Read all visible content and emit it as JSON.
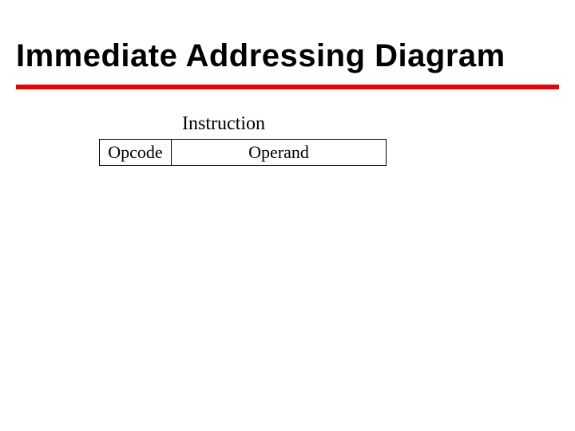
{
  "title": "Immediate Addressing Diagram",
  "diagram": {
    "label": "Instruction",
    "fields": {
      "opcode": "Opcode",
      "operand": "Operand"
    }
  }
}
